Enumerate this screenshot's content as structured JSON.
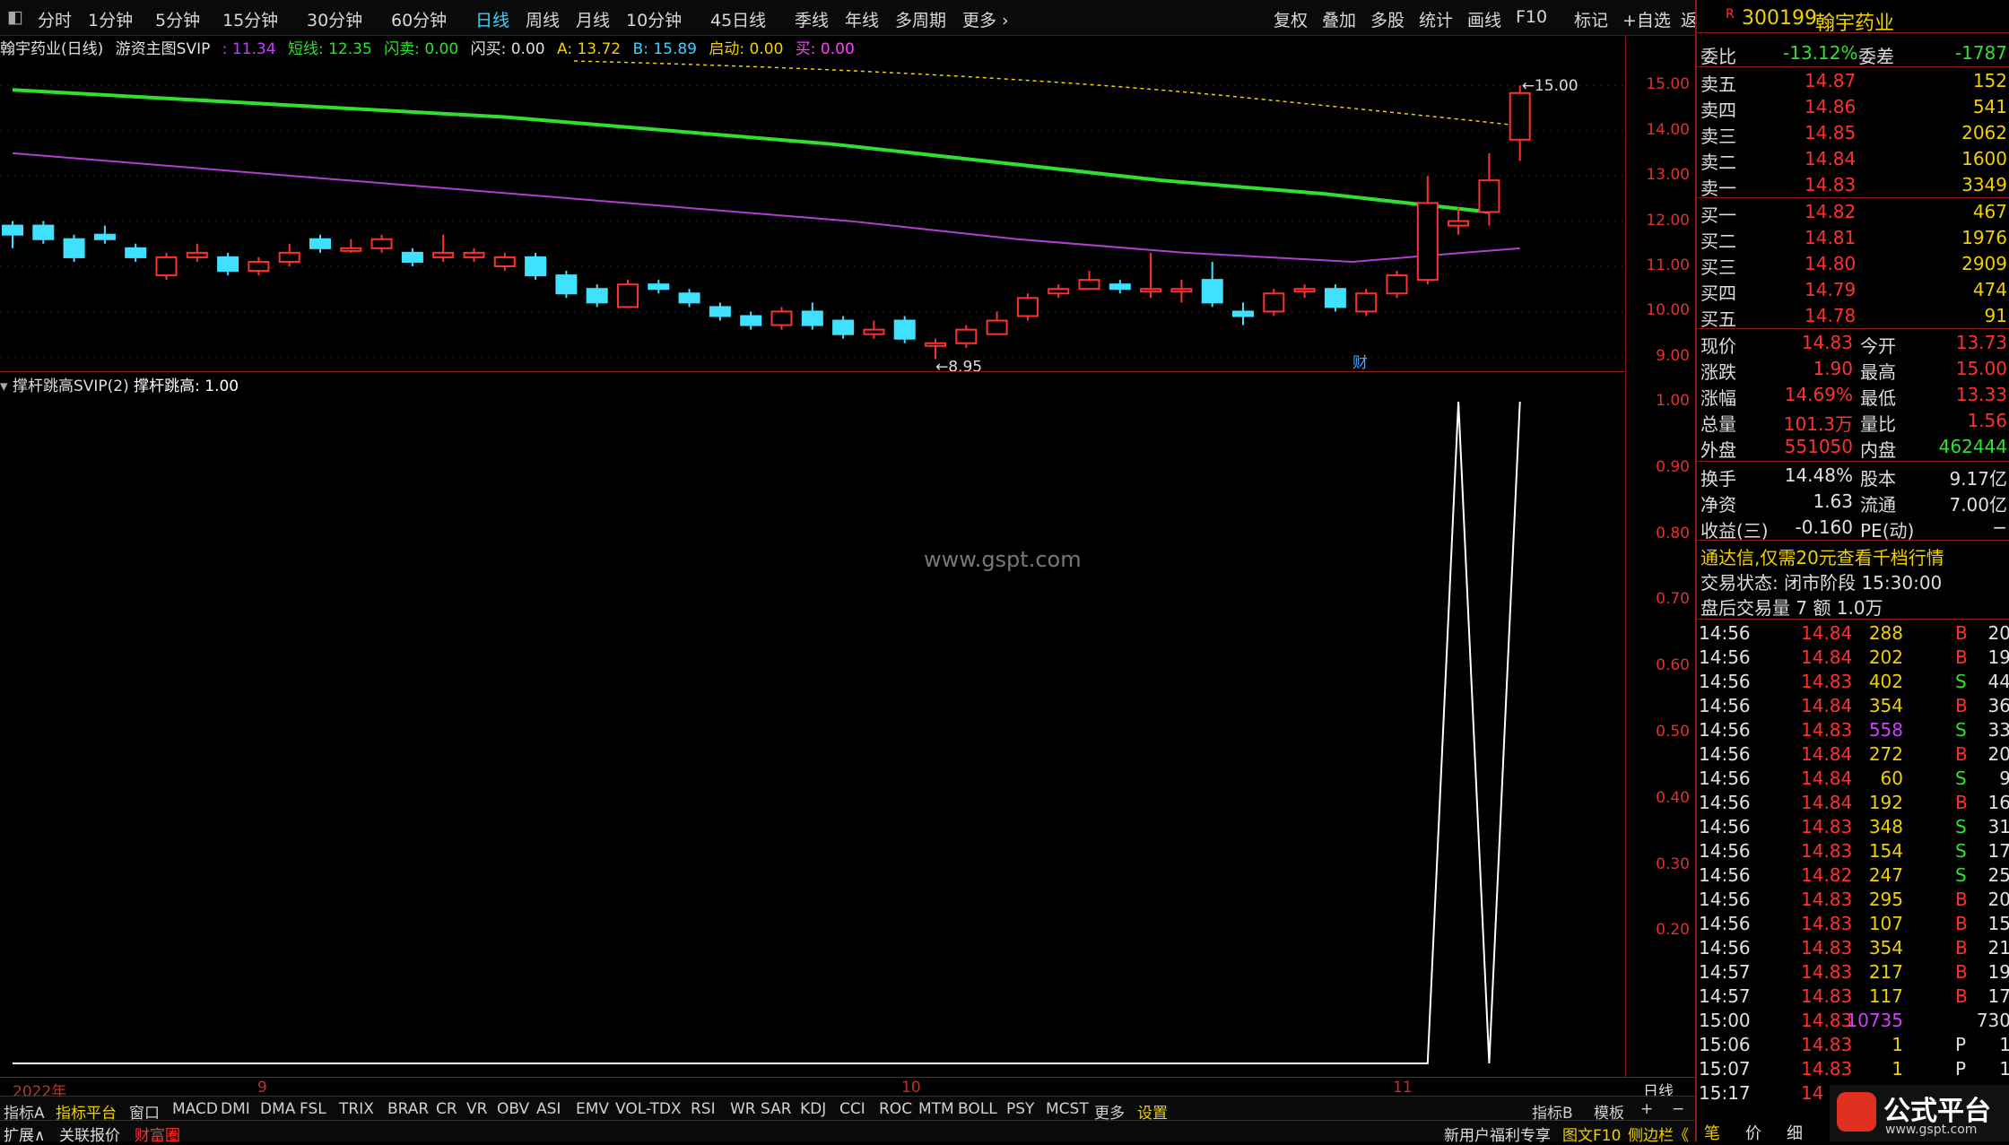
{
  "topbar": {
    "menu_icon": "window-icon",
    "periods": [
      "分时",
      "1分钟",
      "5分钟",
      "15分钟",
      "30分钟",
      "60分钟",
      "日线",
      "周线",
      "月线",
      "10分钟",
      "45日线",
      "季线",
      "年线",
      "多周期",
      "更多"
    ],
    "active_period": "日线",
    "tools": [
      "复权",
      "叠加",
      "多股",
      "统计",
      "画线",
      "F10",
      "标记",
      "+自选",
      "返回"
    ]
  },
  "infoline": {
    "stock": "翰宇药业(日线)",
    "formula": "游资主图SVIP",
    "v1": ": 11.34",
    "short_label": "短线: 12.35",
    "flash_sell": "闪卖: 0.00",
    "flash_buy": "闪买: 0.00",
    "a": "A: 13.72",
    "b": "B: 15.89",
    "start": "启动: 0.00",
    "buy": "买: 0.00"
  },
  "main_chart": {
    "y_ticks": [
      "15.00",
      "14.00",
      "13.00",
      "12.00",
      "11.00",
      "10.00",
      "9.00"
    ],
    "high_label": "15.00",
    "low_label": "8.95",
    "cai_badge": "财"
  },
  "chart_data": {
    "type": "candlestick",
    "y_range": [
      8.8,
      15.5
    ],
    "candles": [
      {
        "o": 11.9,
        "c": 11.7,
        "h": 12.0,
        "l": 11.4
      },
      {
        "o": 11.9,
        "c": 11.6,
        "h": 12.0,
        "l": 11.5
      },
      {
        "o": 11.6,
        "c": 11.2,
        "h": 11.7,
        "l": 11.1
      },
      {
        "o": 11.7,
        "c": 11.6,
        "h": 11.9,
        "l": 11.5
      },
      {
        "o": 11.4,
        "c": 11.2,
        "h": 11.5,
        "l": 11.1
      },
      {
        "o": 10.8,
        "c": 11.2,
        "h": 11.3,
        "l": 10.7
      },
      {
        "o": 11.2,
        "c": 11.3,
        "h": 11.5,
        "l": 11.1
      },
      {
        "o": 11.2,
        "c": 10.9,
        "h": 11.3,
        "l": 10.8
      },
      {
        "o": 10.9,
        "c": 11.1,
        "h": 11.2,
        "l": 10.8
      },
      {
        "o": 11.1,
        "c": 11.3,
        "h": 11.5,
        "l": 11.0
      },
      {
        "o": 11.6,
        "c": 11.4,
        "h": 11.7,
        "l": 11.3
      },
      {
        "o": 11.4,
        "c": 11.4,
        "h": 11.6,
        "l": 11.3
      },
      {
        "o": 11.4,
        "c": 11.6,
        "h": 11.7,
        "l": 11.3
      },
      {
        "o": 11.3,
        "c": 11.1,
        "h": 11.4,
        "l": 11.0
      },
      {
        "o": 11.2,
        "c": 11.3,
        "h": 11.7,
        "l": 11.1
      },
      {
        "o": 11.2,
        "c": 11.3,
        "h": 11.4,
        "l": 11.1
      },
      {
        "o": 11.0,
        "c": 11.2,
        "h": 11.3,
        "l": 10.9
      },
      {
        "o": 11.2,
        "c": 10.8,
        "h": 11.3,
        "l": 10.7
      },
      {
        "o": 10.8,
        "c": 10.4,
        "h": 10.9,
        "l": 10.3
      },
      {
        "o": 10.5,
        "c": 10.2,
        "h": 10.6,
        "l": 10.1
      },
      {
        "o": 10.1,
        "c": 10.6,
        "h": 10.7,
        "l": 10.1
      },
      {
        "o": 10.6,
        "c": 10.5,
        "h": 10.7,
        "l": 10.4
      },
      {
        "o": 10.4,
        "c": 10.2,
        "h": 10.5,
        "l": 10.1
      },
      {
        "o": 10.1,
        "c": 9.9,
        "h": 10.2,
        "l": 9.8
      },
      {
        "o": 9.9,
        "c": 9.7,
        "h": 10.0,
        "l": 9.6
      },
      {
        "o": 9.7,
        "c": 10.0,
        "h": 10.1,
        "l": 9.6
      },
      {
        "o": 10.0,
        "c": 9.7,
        "h": 10.2,
        "l": 9.6
      },
      {
        "o": 9.8,
        "c": 9.5,
        "h": 9.9,
        "l": 9.4
      },
      {
        "o": 9.5,
        "c": 9.6,
        "h": 9.8,
        "l": 9.4
      },
      {
        "o": 9.8,
        "c": 9.4,
        "h": 9.9,
        "l": 9.3
      },
      {
        "o": 9.3,
        "c": 9.3,
        "h": 9.4,
        "l": 8.95
      },
      {
        "o": 9.3,
        "c": 9.6,
        "h": 9.7,
        "l": 9.2
      },
      {
        "o": 9.5,
        "c": 9.8,
        "h": 10.0,
        "l": 9.5
      },
      {
        "o": 9.9,
        "c": 10.3,
        "h": 10.4,
        "l": 9.8
      },
      {
        "o": 10.4,
        "c": 10.5,
        "h": 10.6,
        "l": 10.3
      },
      {
        "o": 10.5,
        "c": 10.7,
        "h": 10.9,
        "l": 10.5
      },
      {
        "o": 10.6,
        "c": 10.5,
        "h": 10.7,
        "l": 10.4
      },
      {
        "o": 10.5,
        "c": 10.5,
        "h": 11.3,
        "l": 10.3
      },
      {
        "o": 10.5,
        "c": 10.5,
        "h": 10.7,
        "l": 10.2
      },
      {
        "o": 10.7,
        "c": 10.2,
        "h": 11.1,
        "l": 10.1
      },
      {
        "o": 10.0,
        "c": 9.9,
        "h": 10.2,
        "l": 9.7
      },
      {
        "o": 10.0,
        "c": 10.4,
        "h": 10.5,
        "l": 9.9
      },
      {
        "o": 10.5,
        "c": 10.5,
        "h": 10.6,
        "l": 10.3
      },
      {
        "o": 10.5,
        "c": 10.1,
        "h": 10.6,
        "l": 10.0
      },
      {
        "o": 10.0,
        "c": 10.4,
        "h": 10.5,
        "l": 9.9
      },
      {
        "o": 10.4,
        "c": 10.8,
        "h": 10.9,
        "l": 10.3
      },
      {
        "o": 10.7,
        "c": 12.4,
        "h": 13.0,
        "l": 10.6
      },
      {
        "o": 11.9,
        "c": 12.0,
        "h": 12.3,
        "l": 11.7
      },
      {
        "o": 12.2,
        "c": 12.9,
        "h": 13.5,
        "l": 11.9
      },
      {
        "o": 13.8,
        "c": 14.83,
        "h": 15.0,
        "l": 13.33
      }
    ],
    "ma_green": [
      14.9,
      14.7,
      14.5,
      14.3,
      14.0,
      13.7,
      13.3,
      12.9,
      12.6,
      12.2
    ],
    "ma_purple": [
      13.5,
      13.2,
      12.9,
      12.6,
      12.3,
      12.0,
      11.6,
      11.3,
      11.1,
      11.4
    ],
    "sub_indicator": {
      "name": "撑杆跳高SVIP(2)",
      "value_label": "撑杆跳高: 1.00",
      "y_ticks": [
        "1.00",
        "0.90",
        "0.80",
        "0.70",
        "0.60",
        "0.50",
        "0.40",
        "0.30",
        "0.20"
      ],
      "signal_values": [
        0,
        0,
        0,
        0,
        0,
        0,
        0,
        0,
        0,
        0,
        0,
        0,
        0,
        0,
        0,
        0,
        0,
        0,
        0,
        0,
        0,
        0,
        0,
        0,
        0,
        0,
        0,
        0,
        0,
        0,
        0,
        0,
        0,
        0,
        0,
        0,
        0,
        0,
        0,
        0,
        0,
        0,
        0,
        0,
        0,
        0,
        0,
        1,
        0,
        1
      ]
    }
  },
  "watermark": "www.gspt.com",
  "xaxis": {
    "labels": [
      "2022年",
      "9",
      "10",
      "11"
    ],
    "right": "日线"
  },
  "tabbar": {
    "items": [
      "指标A",
      "指标平台",
      "窗口",
      "MACD",
      "DMI",
      "DMA",
      "FSL",
      "TRIX",
      "BRAR",
      "CR",
      "VR",
      "OBV",
      "ASI",
      "EMV",
      "VOL-TDX",
      "RSI",
      "WR",
      "SAR",
      "KDJ",
      "CCI",
      "ROC",
      "MTM",
      "BOLL",
      "PSY",
      "MCST",
      "更多",
      "设置"
    ],
    "right": [
      "指标B",
      "模板",
      "+",
      "−"
    ]
  },
  "bottombar": {
    "left": [
      "扩展∧",
      "关联报价",
      "财富圈"
    ],
    "right": [
      "新用户福利专享",
      "图文F10",
      "侧边栏《"
    ]
  },
  "quote": {
    "code": "300199",
    "name": "翰宇药业",
    "badge": "R",
    "weibi_label": "委比",
    "weibi": "-13.12%",
    "weicha_label": "委差",
    "weicha": "-1787",
    "sells": [
      {
        "l": "卖五",
        "p": "14.87",
        "v": "152"
      },
      {
        "l": "卖四",
        "p": "14.86",
        "v": "541"
      },
      {
        "l": "卖三",
        "p": "14.85",
        "v": "2062"
      },
      {
        "l": "卖二",
        "p": "14.84",
        "v": "1600"
      },
      {
        "l": "卖一",
        "p": "14.83",
        "v": "3349"
      }
    ],
    "buys": [
      {
        "l": "买一",
        "p": "14.82",
        "v": "467"
      },
      {
        "l": "买二",
        "p": "14.81",
        "v": "1976"
      },
      {
        "l": "买三",
        "p": "14.80",
        "v": "2909"
      },
      {
        "l": "买四",
        "p": "14.79",
        "v": "474"
      },
      {
        "l": "买五",
        "p": "14.78",
        "v": "91"
      }
    ],
    "stats": [
      {
        "a": "现价",
        "av": "14.83",
        "b": "今开",
        "bv": "13.73"
      },
      {
        "a": "涨跌",
        "av": "1.90",
        "b": "最高",
        "bv": "15.00"
      },
      {
        "a": "涨幅",
        "av": "14.69%",
        "b": "最低",
        "bv": "13.33"
      },
      {
        "a": "总量",
        "av": "101.3万",
        "b": "量比",
        "bv": "1.56"
      },
      {
        "a": "外盘",
        "av": "551050",
        "b": "内盘",
        "bv": "462444"
      }
    ],
    "stats2": [
      {
        "a": "换手",
        "av": "14.48%",
        "b": "股本",
        "bv": "9.17亿"
      },
      {
        "a": "净资",
        "av": "1.63",
        "b": "流通",
        "bv": "7.00亿"
      },
      {
        "a": "收益(三)",
        "av": "-0.160",
        "b": "PE(动)",
        "bv": "−"
      }
    ],
    "promo": "通达信,仅需20元查看千档行情",
    "trade_status": "交易状态: 闭市阶段 15:30:00",
    "after_hours": "盘后交易量 7 额 1.0万",
    "ticks": [
      {
        "t": "14:56",
        "p": "14.84",
        "v": "288",
        "d": "B",
        "n": "20"
      },
      {
        "t": "14:56",
        "p": "14.84",
        "v": "202",
        "d": "B",
        "n": "19"
      },
      {
        "t": "14:56",
        "p": "14.83",
        "v": "402",
        "d": "S",
        "n": "44"
      },
      {
        "t": "14:56",
        "p": "14.84",
        "v": "354",
        "d": "B",
        "n": "36"
      },
      {
        "t": "14:56",
        "p": "14.83",
        "v": "558",
        "d": "S",
        "n": "33"
      },
      {
        "t": "14:56",
        "p": "14.84",
        "v": "272",
        "d": "B",
        "n": "20"
      },
      {
        "t": "14:56",
        "p": "14.84",
        "v": "60",
        "d": "S",
        "n": "9"
      },
      {
        "t": "14:56",
        "p": "14.84",
        "v": "192",
        "d": "B",
        "n": "16"
      },
      {
        "t": "14:56",
        "p": "14.83",
        "v": "348",
        "d": "S",
        "n": "31"
      },
      {
        "t": "14:56",
        "p": "14.83",
        "v": "154",
        "d": "S",
        "n": "17"
      },
      {
        "t": "14:56",
        "p": "14.82",
        "v": "247",
        "d": "S",
        "n": "25"
      },
      {
        "t": "14:56",
        "p": "14.83",
        "v": "295",
        "d": "B",
        "n": "20"
      },
      {
        "t": "14:56",
        "p": "14.83",
        "v": "107",
        "d": "B",
        "n": "15"
      },
      {
        "t": "14:56",
        "p": "14.83",
        "v": "354",
        "d": "B",
        "n": "21"
      },
      {
        "t": "14:57",
        "p": "14.83",
        "v": "217",
        "d": "B",
        "n": "19"
      },
      {
        "t": "14:57",
        "p": "14.83",
        "v": "117",
        "d": "B",
        "n": "17"
      },
      {
        "t": "15:00",
        "p": "14.83",
        "v": "10735",
        "d": "",
        "n": "730"
      },
      {
        "t": "15:06",
        "p": "14.83",
        "v": "1",
        "d": "P",
        "n": "1"
      },
      {
        "t": "15:07",
        "p": "14.83",
        "v": "1",
        "d": "P",
        "n": "1"
      },
      {
        "t": "15:17",
        "p": "14",
        "v": "",
        "d": "",
        "n": ""
      }
    ],
    "bottom_tabs": [
      "笔",
      "价",
      "细"
    ]
  },
  "logo": {
    "text": "公式平台",
    "sub": "www.gspt.com"
  },
  "colors": {
    "up": "#ff3030",
    "down": "#40e0ff",
    "ma_green": "#30e030",
    "ma_purple": "#b040d0"
  }
}
